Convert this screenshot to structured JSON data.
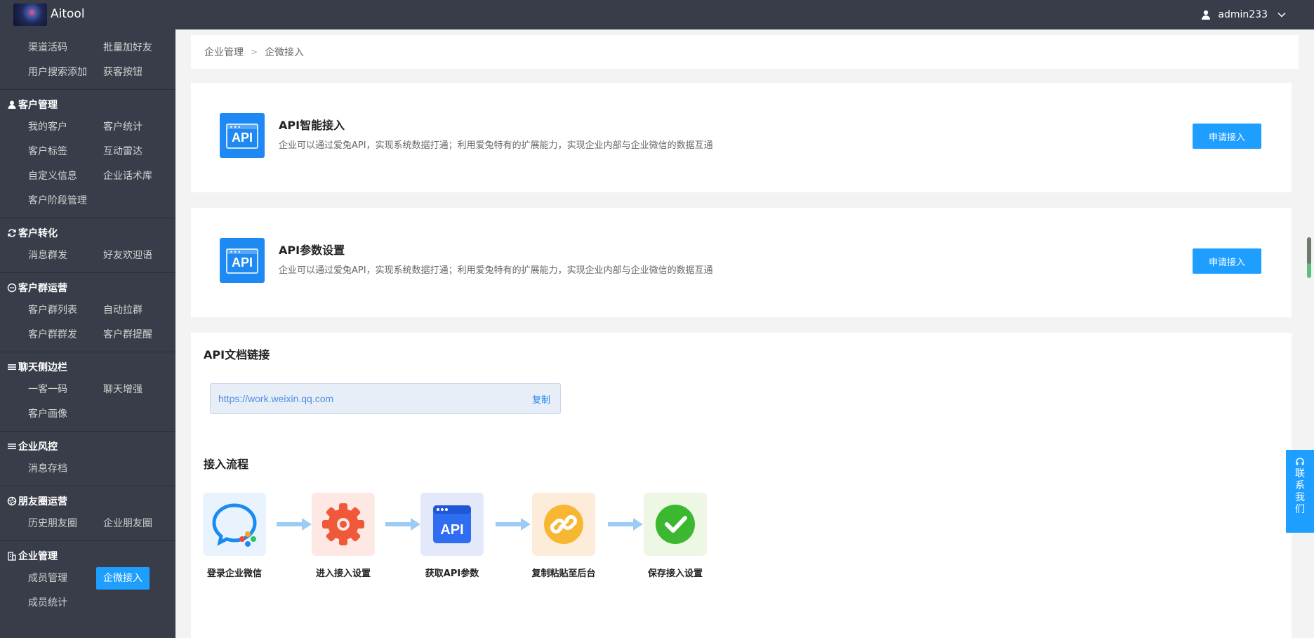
{
  "app": {
    "name": "Aitool"
  },
  "user": {
    "name": "admin233"
  },
  "sidebar": {
    "top_items": [
      "渠道活码",
      "批量加好友",
      "用户搜索添加",
      "获客按钮"
    ],
    "groups": [
      {
        "title": "客户管理",
        "icon": "user-icon",
        "items": [
          "我的客户",
          "客户统计",
          "客户标签",
          "互动雷达",
          "自定义信息",
          "企业话术库",
          "客户阶段管理"
        ]
      },
      {
        "title": "客户转化",
        "icon": "refresh-icon",
        "items": [
          "消息群发",
          "好友欢迎语"
        ]
      },
      {
        "title": "客户群运营",
        "icon": "chat-icon",
        "items": [
          "客户群列表",
          "自动拉群",
          "客户群群发",
          "客户群提醒"
        ]
      },
      {
        "title": "聊天侧边栏",
        "icon": "menu-icon",
        "items": [
          "一客一码",
          "聊天增强",
          "客户画像"
        ]
      },
      {
        "title": "企业风控",
        "icon": "menu-icon",
        "items": [
          "消息存档"
        ]
      },
      {
        "title": "朋友圈运营",
        "icon": "aperture-icon",
        "items": [
          "历史朋友圈",
          "企业朋友圈"
        ]
      },
      {
        "title": "企业管理",
        "icon": "building-icon",
        "items": [
          "成员管理",
          "企微接入",
          "成员统计"
        ],
        "active": "企微接入"
      }
    ]
  },
  "breadcrumb": [
    "企业管理",
    "企微接入"
  ],
  "api_cards": [
    {
      "title": "API智能接入",
      "desc": "企业可以通过爱兔API，实现系统数据打通；利用爱兔特有的扩展能力，实现企业内部与企业微信的数据互通",
      "button": "申请接入",
      "icon_text": "API"
    },
    {
      "title": "API参数设置",
      "desc": "企业可以通过爱兔API，实现系统数据打通；利用爱兔特有的扩展能力，实现企业内部与企业微信的数据互通",
      "button": "申请接入",
      "icon_text": "API"
    }
  ],
  "doc": {
    "title": "API文档链接",
    "url": "https://work.weixin.qq.com",
    "copy": "复制"
  },
  "process": {
    "title": "接入流程",
    "steps": [
      {
        "label": "登录企业微信",
        "icon": "wecom-icon",
        "bg": "#e8f3fd"
      },
      {
        "label": "进入接入设置",
        "icon": "gear-icon",
        "bg": "#fde8e4"
      },
      {
        "label": "获取API参数",
        "icon": "api-icon",
        "bg": "#e3e9fb"
      },
      {
        "label": "复制粘贴至后台",
        "icon": "link-icon",
        "bg": "#fdecd9"
      },
      {
        "label": "保存接入设置",
        "icon": "check-icon",
        "bg": "#eef7e4"
      }
    ]
  },
  "contact": {
    "label": "联系我们",
    "chars": [
      "联",
      "系",
      "我",
      "们"
    ]
  },
  "colors": {
    "primary": "#1e9fff",
    "sidebar": "#393d49"
  }
}
